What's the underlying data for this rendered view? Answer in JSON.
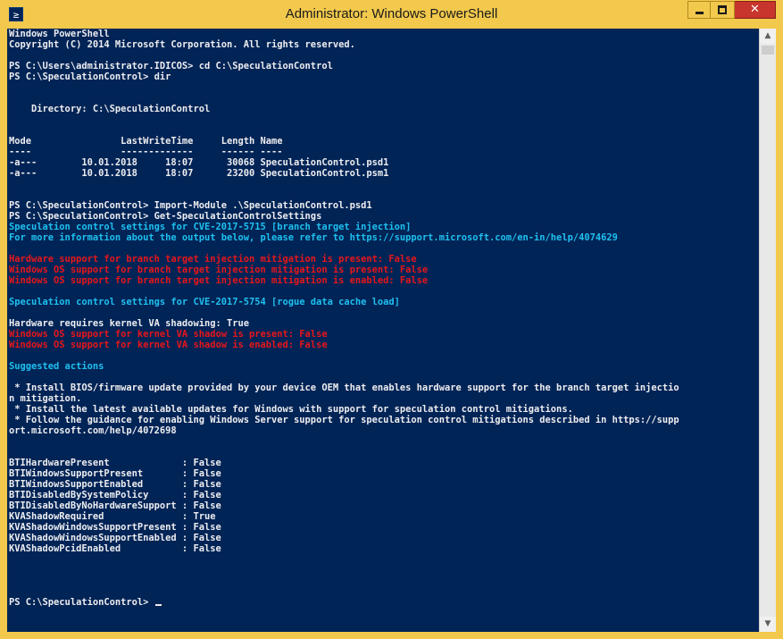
{
  "window": {
    "title": "Administrator: Windows PowerShell",
    "icon": "powershell-icon",
    "icon_glyph": "≥",
    "controls": {
      "minimize": "minimize-icon",
      "maximize": "maximize-icon",
      "close_label": "✕"
    }
  },
  "colors": {
    "console_bg": "#012456",
    "text": "#eeedf0",
    "cyan": "#1fc0f0",
    "red": "#e8161b",
    "titlebar": "#f2c94c",
    "close": "#c7352d"
  },
  "console": {
    "lines": [
      "Windows PowerShell",
      "Copyright (C) 2014 Microsoft Corporation. All rights reserved.",
      "",
      "PS C:\\Users\\administrator.IDICOS> cd C:\\SpeculationControl",
      "PS C:\\SpeculationControl> dir",
      "",
      "",
      "    Directory: C:\\SpeculationControl",
      "",
      "",
      "Mode                LastWriteTime     Length Name",
      "----                -------------     ------ ----",
      "-a---        10.01.2018     18:07      30068 SpeculationControl.psd1",
      "-a---        10.01.2018     18:07      23200 SpeculationControl.psm1",
      "",
      "",
      "PS C:\\SpeculationControl> Import-Module .\\SpeculationControl.psd1",
      "PS C:\\SpeculationControl> Get-SpeculationControlSettings",
      "Speculation control settings for CVE-2017-5715 [branch target injection]",
      "For more information about the output below, please refer to https://support.microsoft.com/en-in/help/4074629",
      "",
      "Hardware support for branch target injection mitigation is present: False",
      "Windows OS support for branch target injection mitigation is present: False",
      "Windows OS support for branch target injection mitigation is enabled: False",
      "",
      "Speculation control settings for CVE-2017-5754 [rogue data cache load]",
      "",
      "Hardware requires kernel VA shadowing: True",
      "Windows OS support for kernel VA shadow is present: False",
      "Windows OS support for kernel VA shadow is enabled: False",
      "",
      "Suggested actions",
      "",
      " * Install BIOS/firmware update provided by your device OEM that enables hardware support for the branch target injectio",
      "n mitigation.",
      " * Install the latest available updates for Windows with support for speculation control mitigations.",
      " * Follow the guidance for enabling Windows Server support for speculation control mitigations described in https://supp",
      "ort.microsoft.com/help/4072698",
      "",
      "",
      "BTIHardwarePresent             : False",
      "BTIWindowsSupportPresent       : False",
      "BTIWindowsSupportEnabled       : False",
      "BTIDisabledBySystemPolicy      : False",
      "BTIDisabledByNoHardwareSupport : False",
      "KVAShadowRequired              : True",
      "KVAShadowWindowsSupportPresent : False",
      "KVAShadowWindowsSupportEnabled : False",
      "KVAShadowPcidEnabled           : False",
      "",
      "",
      "",
      "",
      "PS C:\\SpeculationControl> "
    ],
    "line_styles": {
      "18": "cyan",
      "19": "cyan",
      "21": "red",
      "22": "red",
      "23": "red",
      "25": "cyan",
      "28": "red",
      "29": "red",
      "31": "cyan"
    }
  },
  "scrollbar": {
    "up": "▲",
    "down": "▼"
  }
}
